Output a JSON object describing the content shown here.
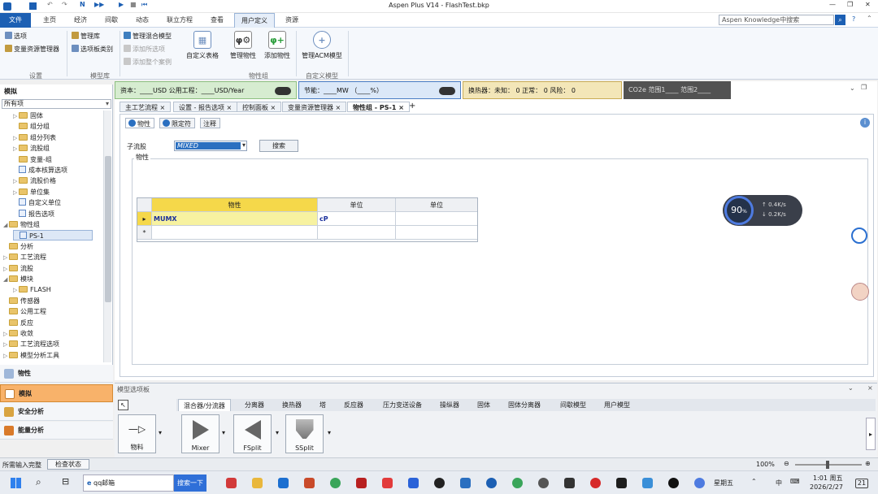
{
  "window": {
    "title": "Aspen Plus V14 - FlashTest.bkp"
  },
  "ribbon_tabs": [
    "文件",
    "主页",
    "经济",
    "间歇",
    "动态",
    "联立方程",
    "查看",
    "用户定义",
    "资源"
  ],
  "search": {
    "placeholder": "Aspen Knowledge中搜索"
  },
  "ribbon": {
    "setup_group": {
      "items": [
        "选项",
        "变量资源管理器"
      ],
      "label": "设置"
    },
    "model_lib_group": {
      "items": [
        "管理库",
        "选项板类别"
      ],
      "label": "模型库"
    },
    "mixture_group": {
      "items": [
        "管理混合模型",
        "添加所选项",
        "添加整个案例"
      ]
    },
    "custom_table": "自定义表格",
    "manage_property": "管理物性",
    "add_property": "添加物性",
    "property_group_label": "物性组",
    "manage_acm": "管理ACM模型",
    "custom_model_label": "自定义模型"
  },
  "nav": {
    "header": "模拟",
    "filter": "所有项",
    "tree": [
      {
        "label": "固体",
        "exp": "▷",
        "type": "folder"
      },
      {
        "label": "组分组",
        "exp": "",
        "type": "folder"
      },
      {
        "label": "组分列表",
        "exp": "▷",
        "type": "folder"
      },
      {
        "label": "流股组",
        "exp": "▷",
        "type": "folder"
      },
      {
        "label": "变量-组",
        "exp": "",
        "type": "folder"
      },
      {
        "label": "成本核算选项",
        "exp": "",
        "type": "form"
      },
      {
        "label": "流股价格",
        "exp": "▷",
        "type": "folder"
      },
      {
        "label": "单位集",
        "exp": "▷",
        "type": "folder"
      },
      {
        "label": "自定义单位",
        "exp": "",
        "type": "form"
      },
      {
        "label": "报告选项",
        "exp": "",
        "type": "form"
      },
      {
        "label": "物性组",
        "exp": "◢",
        "type": "folder"
      },
      {
        "label": "PS-1",
        "exp": "",
        "type": "form"
      },
      {
        "label": "分析",
        "exp": "",
        "type": "folder"
      },
      {
        "label": "工艺流程",
        "exp": "▷",
        "type": "folder"
      },
      {
        "label": "流股",
        "exp": "▷",
        "type": "folder"
      },
      {
        "label": "模块",
        "exp": "◢",
        "type": "folder"
      },
      {
        "label": "FLASH",
        "exp": "▷",
        "type": "folder"
      },
      {
        "label": "传感器",
        "exp": "",
        "type": "folder"
      },
      {
        "label": "公用工程",
        "exp": "",
        "type": "folder"
      },
      {
        "label": "反应",
        "exp": "",
        "type": "folder"
      },
      {
        "label": "收敛",
        "exp": "▷",
        "type": "folder"
      },
      {
        "label": "工艺流程选项",
        "exp": "▷",
        "type": "folder"
      },
      {
        "label": "模型分析工具",
        "exp": "▷",
        "type": "folder"
      }
    ],
    "buttons": [
      "物性",
      "模拟",
      "安全分析",
      "能量分析"
    ]
  },
  "status_bar_top": {
    "cost": "资本：____USD  公用工程：____USD/Year",
    "energy": "节能：____MW  （____%）",
    "exchanger": "换热器：未知：  0   正常：  0   风险：  0",
    "co2": "CO2e 范围1____  范围2____"
  },
  "doc_tabs": [
    "主工艺流程",
    "设置 - 报告选项",
    "控制面板",
    "变量资源管理器",
    "物性组 - PS-1"
  ],
  "sub_tabs": [
    "物性",
    "限定符",
    "注释"
  ],
  "form": {
    "substream_label": "子流股",
    "substream_value": "MIXED",
    "search_button": "搜索",
    "section_label": "物性",
    "col_headers": [
      "物性",
      "单位",
      "单位"
    ],
    "rows": [
      [
        "MUMX",
        "cP",
        ""
      ]
    ]
  },
  "widget": {
    "percent": "90",
    "pct_sign": "%",
    "up": "0.4K/s",
    "down": "0.2K/s"
  },
  "palette": {
    "title": "模型选项板",
    "tabs": [
      "混合器/分流器",
      "分离器",
      "换热器",
      "塔",
      "反应器",
      "压力变送设备",
      "操纵器",
      "固体",
      "固体分离器",
      "间歇模型",
      "用户模型"
    ],
    "items": [
      "物料",
      "Mixer",
      "FSplit",
      "SSplit"
    ]
  },
  "statusbar": {
    "left": "所需输入完整",
    "check": "检查状态",
    "zoom": "100%"
  },
  "taskbar": {
    "search_text": "qq邮箱",
    "search_button": "搜索一下",
    "weekday": "星期五",
    "lang": "中",
    "time": "1:01 周五",
    "date": "2026/2/27",
    "notif": "21"
  }
}
